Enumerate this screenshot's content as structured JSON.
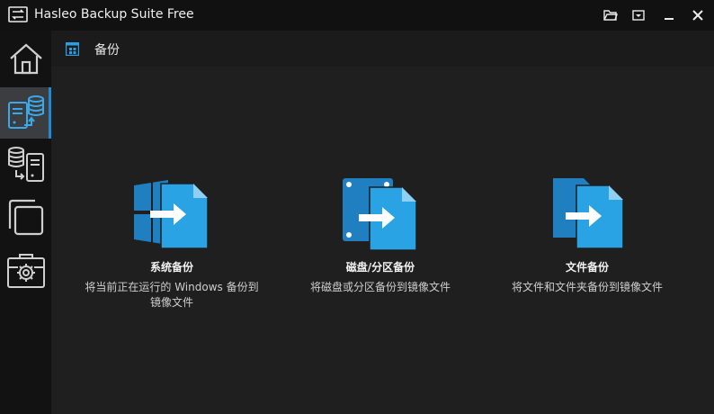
{
  "window": {
    "title": "Hasleo Backup Suite Free",
    "icons": [
      "app-logo-icon",
      "folder-open-icon",
      "dropdown-menu-icon",
      "minimize-icon",
      "close-icon"
    ]
  },
  "sidebar": {
    "items": [
      {
        "name": "home",
        "icon": "home-icon",
        "active": false
      },
      {
        "name": "backup",
        "icon": "backup-icon",
        "active": true
      },
      {
        "name": "restore",
        "icon": "restore-icon",
        "active": false
      },
      {
        "name": "clone",
        "icon": "clone-icon",
        "active": false
      },
      {
        "name": "tools",
        "icon": "toolbox-icon",
        "active": false
      }
    ]
  },
  "header": {
    "title": "备份"
  },
  "cards": [
    {
      "title": "系统备份",
      "desc_line1": "将当前正在运行的 Windows 备份到",
      "desc_line2": "镜像文件"
    },
    {
      "title": "磁盘/分区备份",
      "desc_line1": "将磁盘或分区备份到镜像文件",
      "desc_line2": ""
    },
    {
      "title": "文件备份",
      "desc_line1": "将文件和文件夹备份到镜像文件",
      "desc_line2": ""
    }
  ],
  "colors": {
    "accent": "#29a3e3",
    "accent_dark": "#1f7fc0"
  }
}
